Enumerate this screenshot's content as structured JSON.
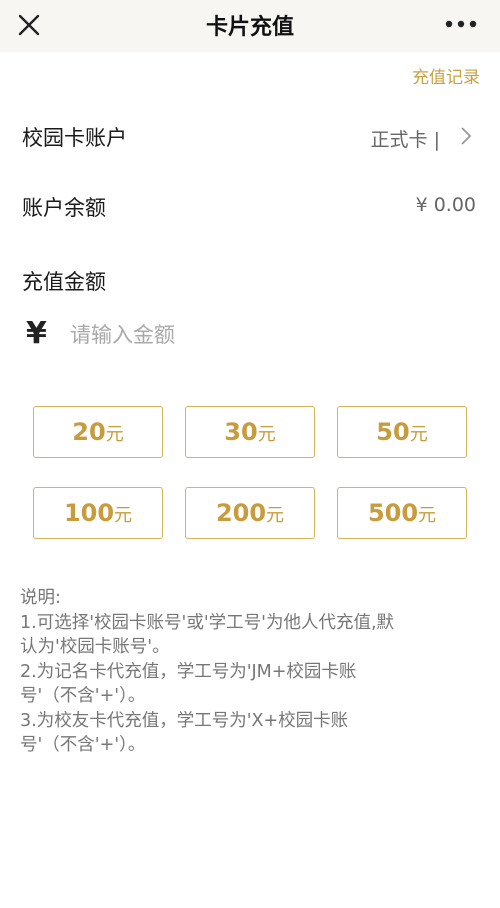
{
  "header": {
    "title": "卡片充值"
  },
  "record_link": "充值记录",
  "account": {
    "label": "校园卡账户",
    "value": "正式卡 |"
  },
  "balance": {
    "label": "账户余额",
    "value": "¥ 0.00"
  },
  "amount": {
    "label": "充值金额",
    "currency_symbol": "¥",
    "placeholder": "请输入金额"
  },
  "quick_amounts": [
    {
      "value": "20",
      "unit": "元"
    },
    {
      "value": "30",
      "unit": "元"
    },
    {
      "value": "50",
      "unit": "元"
    },
    {
      "value": "100",
      "unit": "元"
    },
    {
      "value": "200",
      "unit": "元"
    },
    {
      "value": "500",
      "unit": "元"
    }
  ],
  "notes": {
    "title": "说明:",
    "lines": [
      "1.可选择'校园卡账号'或'学工号'为他人代充值,默",
      "认为'校园卡账号'。",
      "2.为记名卡代充值，学工号为'JM+校园卡账",
      "号'（不含'+'）。",
      "3.为校友卡代充值，学工号为'X+校园卡账",
      "号'（不含'+'）。"
    ]
  },
  "colors": {
    "accent": "#c89b3c",
    "header_bg": "#f7f6f2"
  },
  "icons": {
    "close": "close-icon",
    "more": "more-icon",
    "chevron": "chevron-right-icon"
  }
}
